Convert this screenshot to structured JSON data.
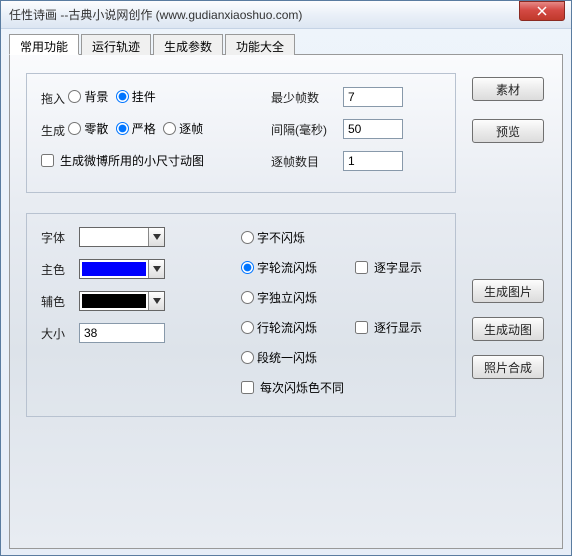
{
  "title": "任性诗画 --古典小说网创作 (www.gudianxiaoshuo.com)",
  "tabs": [
    "常用功能",
    "运行轨迹",
    "生成参数",
    "功能大全"
  ],
  "group1": {
    "drag_label": "拖入",
    "drag_opts": [
      "背景",
      "挂件"
    ],
    "gen_label": "生成",
    "gen_opts": [
      "零散",
      "严格",
      "逐帧"
    ],
    "chk_small": "生成微博所用的小尺寸动图",
    "min_frames_label": "最少帧数",
    "min_frames": "7",
    "interval_label": "间隔(毫秒)",
    "interval": "50",
    "frame_count_label": "逐帧数目",
    "frame_count": "1"
  },
  "group2": {
    "font_label": "字体",
    "font_value": "",
    "main_color_label": "主色",
    "main_color": "#0000ff",
    "aux_color_label": "辅色",
    "aux_color": "#000000",
    "size_label": "大小",
    "size": "38",
    "r_noflash": "字不闪烁",
    "r_rotate": "字轮流闪烁",
    "chk_bychar": "逐字显示",
    "r_indep": "字独立闪烁",
    "r_lineflash": "行轮流闪烁",
    "chk_byline": "逐行显示",
    "r_segflash": "段统一闪烁",
    "chk_diffcolor": "每次闪烁色不同"
  },
  "buttons": {
    "material": "素材",
    "preview": "预览",
    "gen_image": "生成图片",
    "gen_anim": "生成动图",
    "photo_merge": "照片合成"
  }
}
